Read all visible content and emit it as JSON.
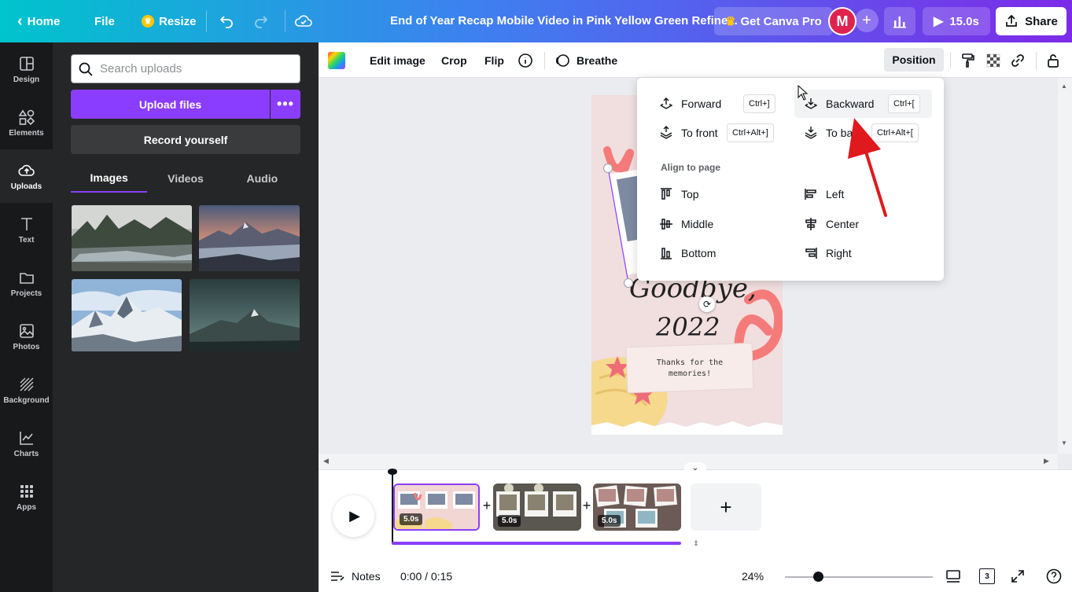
{
  "topbar": {
    "home_label": "Home",
    "file_label": "File",
    "resize_label": "Resize",
    "doc_title": "End of Year Recap Mobile Video in Pink Yellow Green Refine...",
    "pro_label": "Get Canva Pro",
    "avatar_initial": "M",
    "play_duration": "15.0s",
    "share_label": "Share"
  },
  "rail": [
    {
      "label": "Design",
      "icon": "design-icon"
    },
    {
      "label": "Elements",
      "icon": "elements-icon"
    },
    {
      "label": "Uploads",
      "icon": "uploads-icon"
    },
    {
      "label": "Text",
      "icon": "text-icon"
    },
    {
      "label": "Projects",
      "icon": "folder-icon"
    },
    {
      "label": "Photos",
      "icon": "photo-icon"
    },
    {
      "label": "Background",
      "icon": "background-icon"
    },
    {
      "label": "Charts",
      "icon": "chart-icon"
    },
    {
      "label": "Apps",
      "icon": "apps-icon"
    }
  ],
  "panel": {
    "search_placeholder": "Search uploads",
    "upload_label": "Upload files",
    "record_label": "Record yourself",
    "tabs": [
      "Images",
      "Videos",
      "Audio"
    ],
    "active_tab": "Images"
  },
  "editor_toolbar": {
    "edit_image": "Edit image",
    "crop": "Crop",
    "flip": "Flip",
    "breathe": "Breathe",
    "position": "Position"
  },
  "position_menu": {
    "forward": {
      "label": "Forward",
      "shortcut": "Ctrl+]"
    },
    "backward": {
      "label": "Backward",
      "shortcut": "Ctrl+["
    },
    "to_front": {
      "label": "To front",
      "shortcut": "Ctrl+Alt+]"
    },
    "to_back": {
      "label": "To back",
      "shortcut": "Ctrl+Alt+["
    },
    "align_heading": "Align to page",
    "align": {
      "top": "Top",
      "left": "Left",
      "middle": "Middle",
      "center": "Center",
      "bottom": "Bottom",
      "right": "Right"
    }
  },
  "page_content": {
    "heading_line1": "Goodbye,",
    "heading_line2": "2022",
    "note": "Thanks for the memories!"
  },
  "timeline": {
    "clips": [
      {
        "duration": "5.0s"
      },
      {
        "duration": "5.0s"
      },
      {
        "duration": "5.0s"
      }
    ]
  },
  "footer": {
    "notes_label": "Notes",
    "time": "0:00 / 0:15",
    "zoom": "24%",
    "pages_count": "3"
  },
  "colors": {
    "accent": "#8b3dff",
    "arrow": "#e0191f"
  }
}
